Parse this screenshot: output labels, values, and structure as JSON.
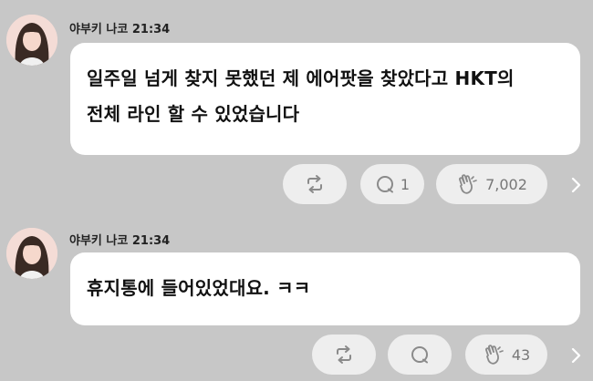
{
  "colors": {
    "background": "#c7c7c7",
    "bubble": "#ffffff",
    "action_pill": "#eeeeee",
    "icon": "#8a8a8a"
  },
  "messages": [
    {
      "sender": "야부키 나코 21:34",
      "avatar": "avatar-photo",
      "text": "일주일 넘게 찾지 못했던 제 에어팟을 찾았다고 HKT의\n전체 라인 할 수 있었습니다",
      "actions": {
        "repost_icon": "repost-icon",
        "comment_icon": "comment-icon",
        "comment_count": "1",
        "clap_icon": "clap-icon",
        "clap_count": "7,002",
        "more_icon": "chevron-right-icon"
      }
    },
    {
      "sender": "야부키 나코 21:34",
      "avatar": "avatar-photo",
      "text": "휴지통에 들어있었대요. ㅋㅋ",
      "actions": {
        "repost_icon": "repost-icon",
        "comment_icon": "comment-icon",
        "comment_count": "",
        "clap_icon": "clap-icon",
        "clap_count": "43",
        "more_icon": "chevron-right-icon"
      }
    }
  ]
}
